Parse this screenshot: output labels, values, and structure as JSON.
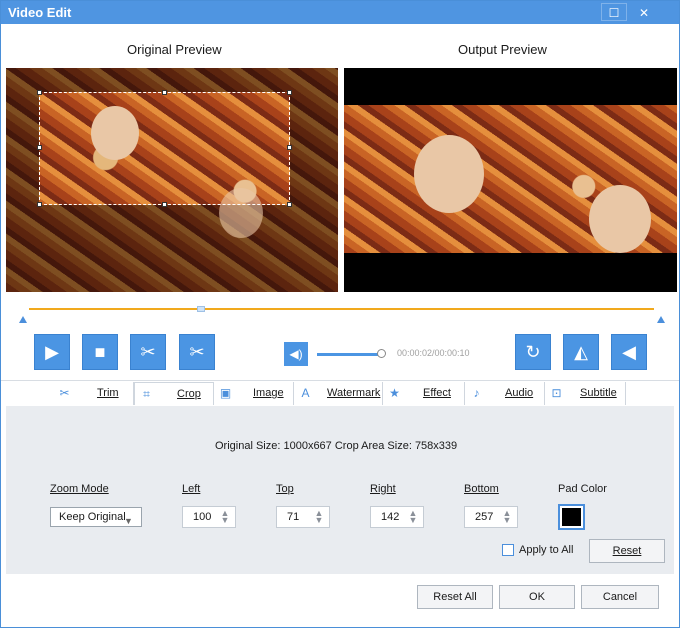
{
  "window": {
    "title": "Video Edit"
  },
  "previews": {
    "original_label": "Original Preview",
    "output_label": "Output Preview"
  },
  "player": {
    "timecode": "00:00:02/00:00:10",
    "volume": 0.9
  },
  "tabs": [
    {
      "label": "Trim",
      "icon": "scissors-icon"
    },
    {
      "label": "Crop",
      "icon": "crop-icon"
    },
    {
      "label": "Image",
      "icon": "image-icon"
    },
    {
      "label": "Watermark",
      "icon": "watermark-icon"
    },
    {
      "label": "Effect",
      "icon": "star-icon"
    },
    {
      "label": "Audio",
      "icon": "music-icon"
    },
    {
      "label": "Subtitle",
      "icon": "subtitle-icon"
    }
  ],
  "crop": {
    "size_info": "Original Size: 1000x667  Crop Area Size: 758x339",
    "zoom_mode_label": "Zoom Mode",
    "zoom_mode_value": "Keep Original",
    "left_label": "Left",
    "left_value": "100",
    "top_label": "Top",
    "top_value": "71",
    "right_label": "Right",
    "right_value": "142",
    "bottom_label": "Bottom",
    "bottom_value": "257",
    "pad_color_label": "Pad Color",
    "pad_color": "#000000",
    "apply_all_label": "Apply to All",
    "apply_all_checked": false,
    "reset_label": "Reset"
  },
  "footer": {
    "reset_all_label": "Reset All",
    "ok_label": "OK",
    "cancel_label": "Cancel"
  },
  "colors": {
    "accent": "#4b95e3",
    "timeline": "#f1a91d",
    "titlebar": "#4f95e1"
  }
}
